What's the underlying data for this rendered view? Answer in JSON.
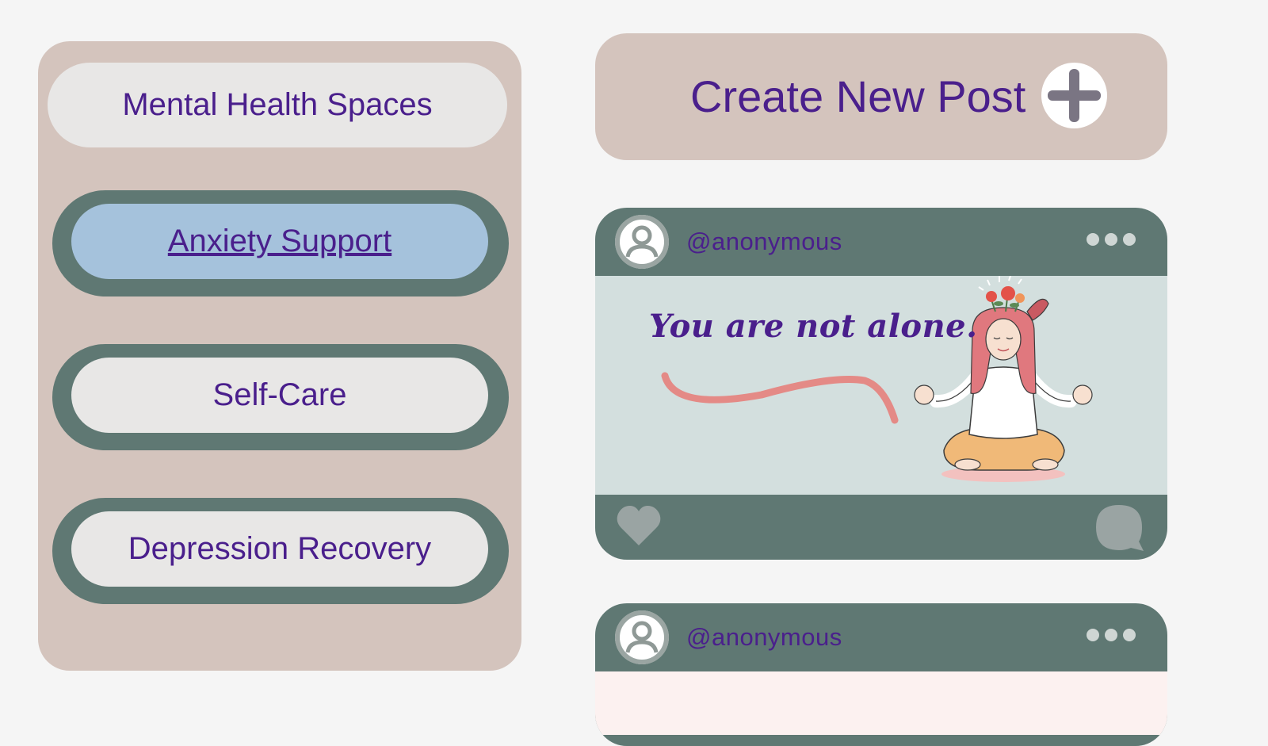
{
  "sidebar": {
    "title": "Mental Health Spaces",
    "items": [
      {
        "label": "Anxiety Support",
        "active": true
      },
      {
        "label": "Self-Care",
        "active": false
      },
      {
        "label": "Depression Recovery",
        "active": false
      }
    ]
  },
  "create_post": {
    "label": "Create New Post",
    "icon": "plus-icon"
  },
  "posts": [
    {
      "username": "@anonymous",
      "image_text": "You are not alone.",
      "icons": [
        "avatar-icon",
        "more-dots-icon",
        "heart-icon",
        "comment-icon"
      ]
    },
    {
      "username": "@anonymous",
      "icons": [
        "avatar-icon",
        "more-dots-icon"
      ]
    }
  ],
  "colors": {
    "page_bg": "#f5f5f5",
    "panel_beige": "#d4c4bd",
    "teal": "#5f7873",
    "pill_light": "#e8e7e6",
    "active_blue": "#a5c2dc",
    "text_purple": "#4a1f8c",
    "post_image_bg": "#d3dfde",
    "accent_pink": "#e48a86"
  }
}
